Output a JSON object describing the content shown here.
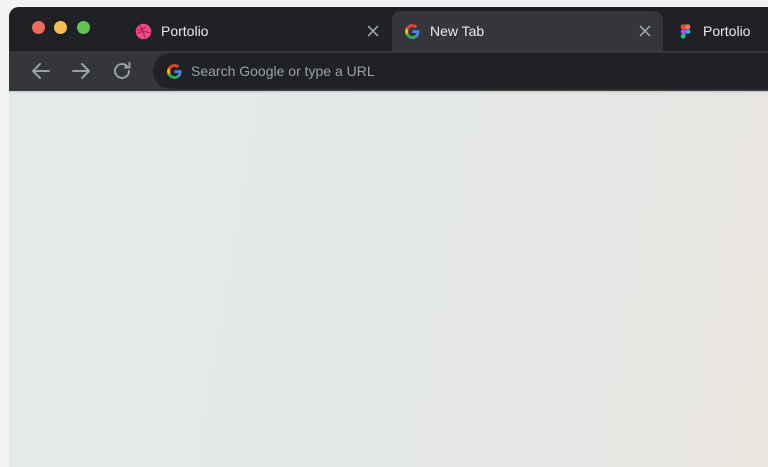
{
  "window": {
    "traffic_lights": {
      "close_color": "#ed6a5e",
      "minimize_color": "#f5bf4f",
      "zoom_color": "#61c554"
    }
  },
  "tabs": [
    {
      "title": "Portolio",
      "icon": "dribbble-icon",
      "active": false,
      "has_close": true
    },
    {
      "title": "New Tab",
      "icon": "google-icon",
      "active": true,
      "has_close": true
    },
    {
      "title": "Portolio",
      "icon": "figma-icon",
      "active": false,
      "has_close": false
    }
  ],
  "toolbar": {
    "back_icon": "arrow-left-icon",
    "forward_icon": "arrow-right-icon",
    "reload_icon": "reload-icon"
  },
  "omnibox": {
    "icon": "google-icon",
    "placeholder": "Search Google or type a URL"
  },
  "colors": {
    "tabstrip": "#202124",
    "active_tab": "#35363a",
    "toolbar": "#35363a",
    "omnibox": "#202124",
    "dribbble_pink": "#ea4c89"
  }
}
